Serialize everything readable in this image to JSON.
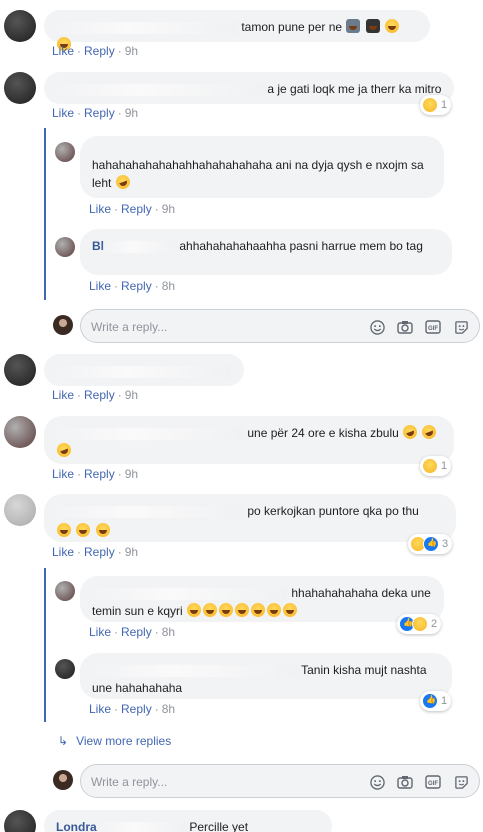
{
  "actions": {
    "like": "Like",
    "reply": "Reply",
    "dot": "·"
  },
  "reply_box": {
    "placeholder": "Write a reply..."
  },
  "view_more": {
    "label": "View more replies",
    "arrow": "↳"
  },
  "comments": [
    {
      "id": "c1",
      "text": "tamon pune per ne",
      "time": "9h"
    },
    {
      "id": "c2",
      "text": "a je gati loqk me ja therr ka mitro",
      "time": "9h",
      "reaction_count": "1"
    },
    {
      "id": "r1",
      "text": "hahahahahahahahhahahahahaha ani na dyja qysh e nxojm sa leht",
      "time": "9h"
    },
    {
      "id": "r2",
      "name_fragment": "Bl",
      "text": "ahhahahahahaahha pasni harrue mem bo tag",
      "time": "8h"
    },
    {
      "id": "c3",
      "text": "",
      "time": "9h"
    },
    {
      "id": "c4",
      "text": "une për 24 ore e kisha zbulu",
      "time": "9h",
      "reaction_count": "1"
    },
    {
      "id": "c5",
      "text": "po kerkojkan puntore qka po thu",
      "time": "9h",
      "reaction_count": "3"
    },
    {
      "id": "r3",
      "text": "hhahahahahaha deka une temin sun e kqyri",
      "time": "8h",
      "reaction_count": "2"
    },
    {
      "id": "r4",
      "text": "Tanin kisha mujt nashta une hahahahaha",
      "time": "8h",
      "reaction_count": "1"
    },
    {
      "id": "c6",
      "name": "Londra",
      "text": "Percille yet"
    }
  ]
}
